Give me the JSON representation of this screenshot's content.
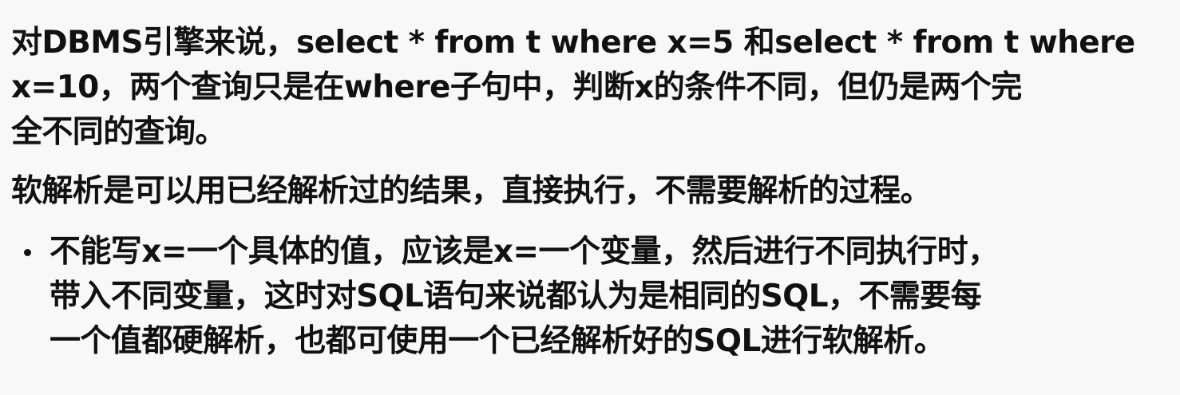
{
  "paragraphs": [
    {
      "lines": [
        "对DBMS引擎来说，select * from t where x=5 和select * from t where",
        "x=10，两个查询只是在where子句中，判断x的条件不同，但仍是两个完",
        "全不同的查询。"
      ]
    },
    {
      "lines": [
        "软解析是可以用已经解析过的结果，直接执行，不需要解析的过程。"
      ]
    }
  ],
  "bullet": {
    "lines": [
      "不能写x=一个具体的值，应该是x=一个变量，然后进行不同执行时，",
      "带入不同变量，这时对SQL语句来说都认为是相同的SQL，不需要每",
      "一个值都硬解析，也都可使用一个已经解析好的SQL进行软解析。"
    ]
  }
}
